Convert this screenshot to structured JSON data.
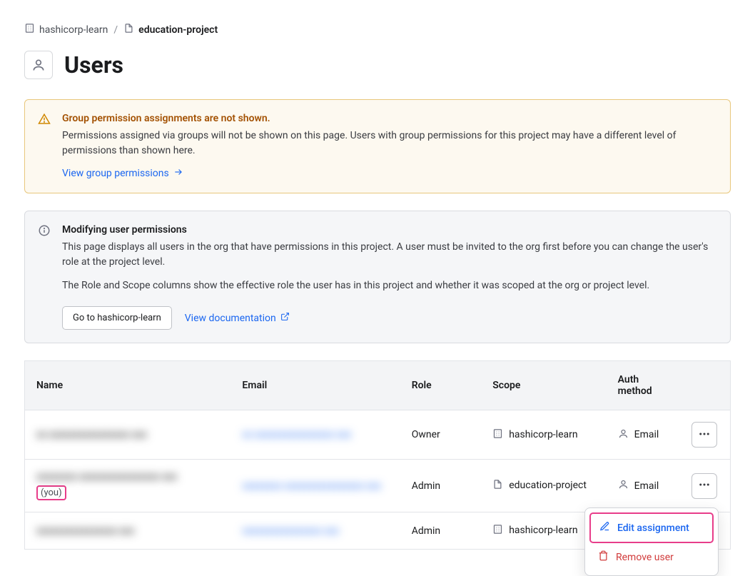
{
  "breadcrumb": {
    "org": "hashicorp-learn",
    "project": "education-project"
  },
  "page": {
    "title": "Users"
  },
  "alerts": {
    "warning": {
      "title": "Group permission assignments are not shown.",
      "body": "Permissions assigned via groups will not be shown on this page. Users with group permissions for this project may have a different level of permissions than shown here.",
      "link_label": "View group permissions"
    },
    "info": {
      "title": "Modifying user permissions",
      "body1": "This page displays all users in the org that have permissions in this project. A user must be invited to the org first before you can change the user's role at the project level.",
      "body2": "The Role and Scope columns show the effective role the user has in this project and whether it was scoped at the org or project level.",
      "goto_label": "Go to hashicorp-learn",
      "doc_label": "View documentation"
    }
  },
  "table": {
    "headers": {
      "name": "Name",
      "email": "Email",
      "role": "Role",
      "scope": "Scope",
      "auth": "Auth method"
    },
    "you_label": "(you)",
    "rows": [
      {
        "name_blur": "xx xxxxxxxxxxxxxxxx xxx",
        "email_blur": "xx xxxxxxxxxxxxxxxx xxx",
        "role": "Owner",
        "scope": "hashicorp-learn",
        "scope_type": "org",
        "auth": "Email",
        "is_you": false,
        "menu_open": false
      },
      {
        "name_blur": "xxxxxxxx xxxxxxxxxxxxxxxx xxx",
        "email_blur": "xxxxxxxx xxxxxxxxxxxxxxxx xxx",
        "role": "Admin",
        "scope": "education-project",
        "scope_type": "project",
        "auth": "Email",
        "is_you": true,
        "menu_open": true
      },
      {
        "name_blur": "xxxxxxxxxxxxxxxx xxx",
        "email_blur": "xxxxxxxxxxxxxxxx xxx",
        "role": "Admin",
        "scope": "hashicorp-learn",
        "scope_type": "org",
        "auth": "",
        "is_you": false,
        "menu_open": false
      }
    ]
  },
  "menu": {
    "edit": "Edit assignment",
    "remove": "Remove user"
  }
}
